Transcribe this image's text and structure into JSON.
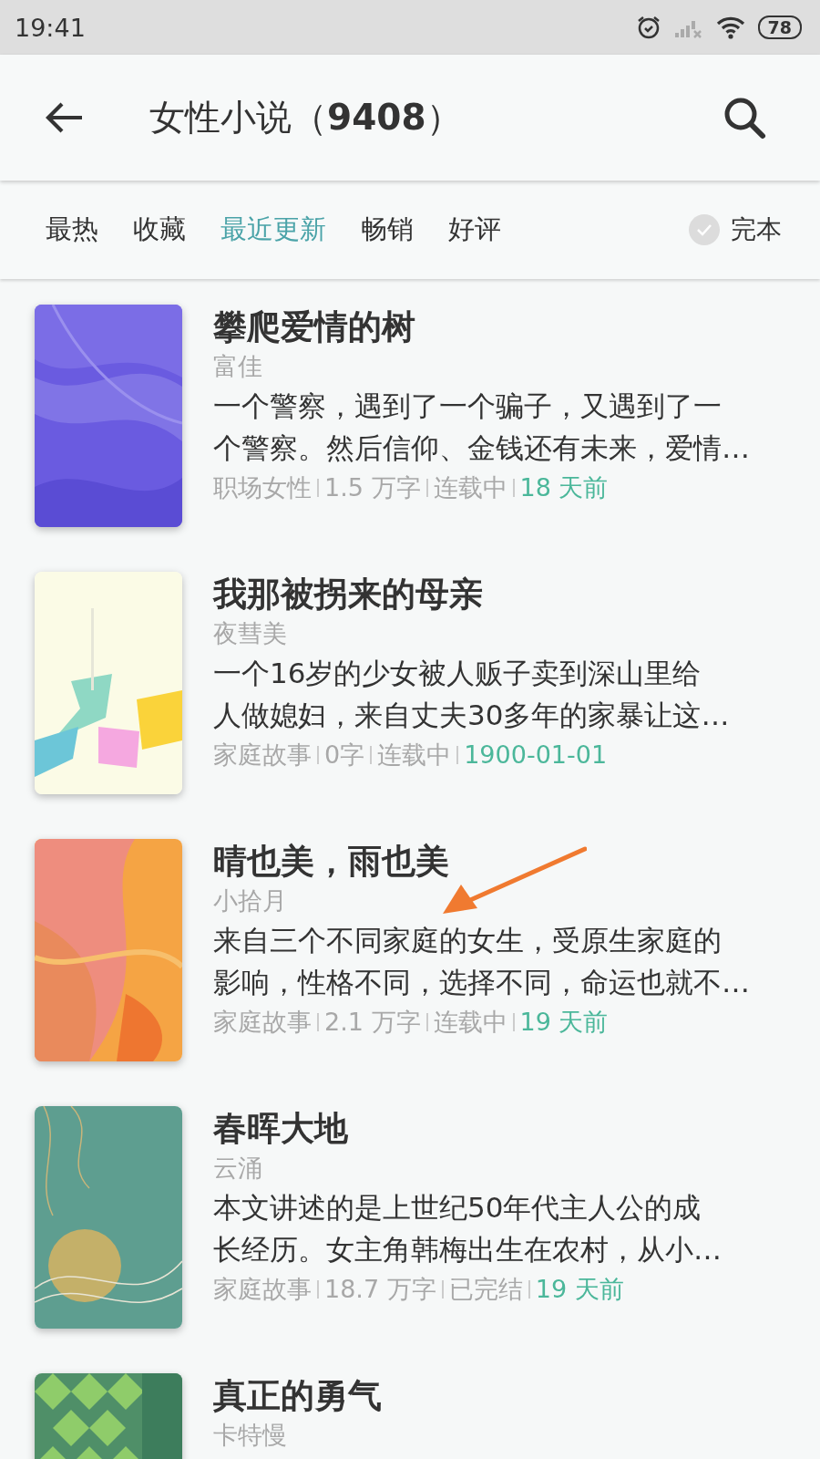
{
  "status_bar": {
    "time": "19:41",
    "battery": "78"
  },
  "header": {
    "title": "女性小说（**9408**）"
  },
  "filter_tabs": [
    {
      "label": "最热",
      "selected": false
    },
    {
      "label": "收藏",
      "selected": false
    },
    {
      "label": "最近更新",
      "selected": true
    },
    {
      "label": "畅销",
      "selected": false
    },
    {
      "label": "好评",
      "selected": false
    }
  ],
  "finished_filter": {
    "label": "完本",
    "checked": false
  },
  "books": [
    {
      "cover": {
        "kind": "picture"
      },
      "title": "攀爬爱情的树",
      "author": "富佳",
      "description_lines": [
        "一个警察，遇到了一个骗子，又遇到了一",
        "个警察。然后信仰、金钱还有未来，爱情…"
      ],
      "meta": [
        "职场女性",
        "1.5 万字",
        "连载中"
      ],
      "updated": "18 天前"
    },
    {
      "cover": {
        "kind": "picture"
      },
      "title": "我那被拐来的母亲",
      "author": "夜彗美",
      "description_lines": [
        "一个16岁的少女被人贩子卖到深山里给",
        "人做媳妇，来自丈夫30多年的家暴让这…"
      ],
      "meta": [
        "家庭故事",
        "0字",
        "连载中"
      ],
      "updated": "1900-01-01"
    },
    {
      "cover": {
        "kind": "picture"
      },
      "title": "晴也美，雨也美",
      "author": "小拾月",
      "description_lines": [
        "来自三个不同家庭的女生，受原生家庭的",
        "影响，性格不同，选择不同，命运也就不…"
      ],
      "meta": [
        "家庭故事",
        "2.1 万字",
        "连载中"
      ],
      "updated": "19 天前"
    },
    {
      "cover": {
        "kind": "picture"
      },
      "title": "春晖大地",
      "author": "云涌",
      "description_lines": [
        "本文讲述的是上世纪50年代主人公的成",
        "长经历。女主角韩梅出生在农村，从小…"
      ],
      "meta": [
        "家庭故事",
        "18.7 万字",
        "已完结"
      ],
      "updated": "19 天前"
    },
    {
      "cover": {
        "kind": "picture"
      },
      "title": "真正的勇气",
      "author": "卡特慢"
    }
  ],
  "annotation": {
    "kind": "arrow"
  }
}
